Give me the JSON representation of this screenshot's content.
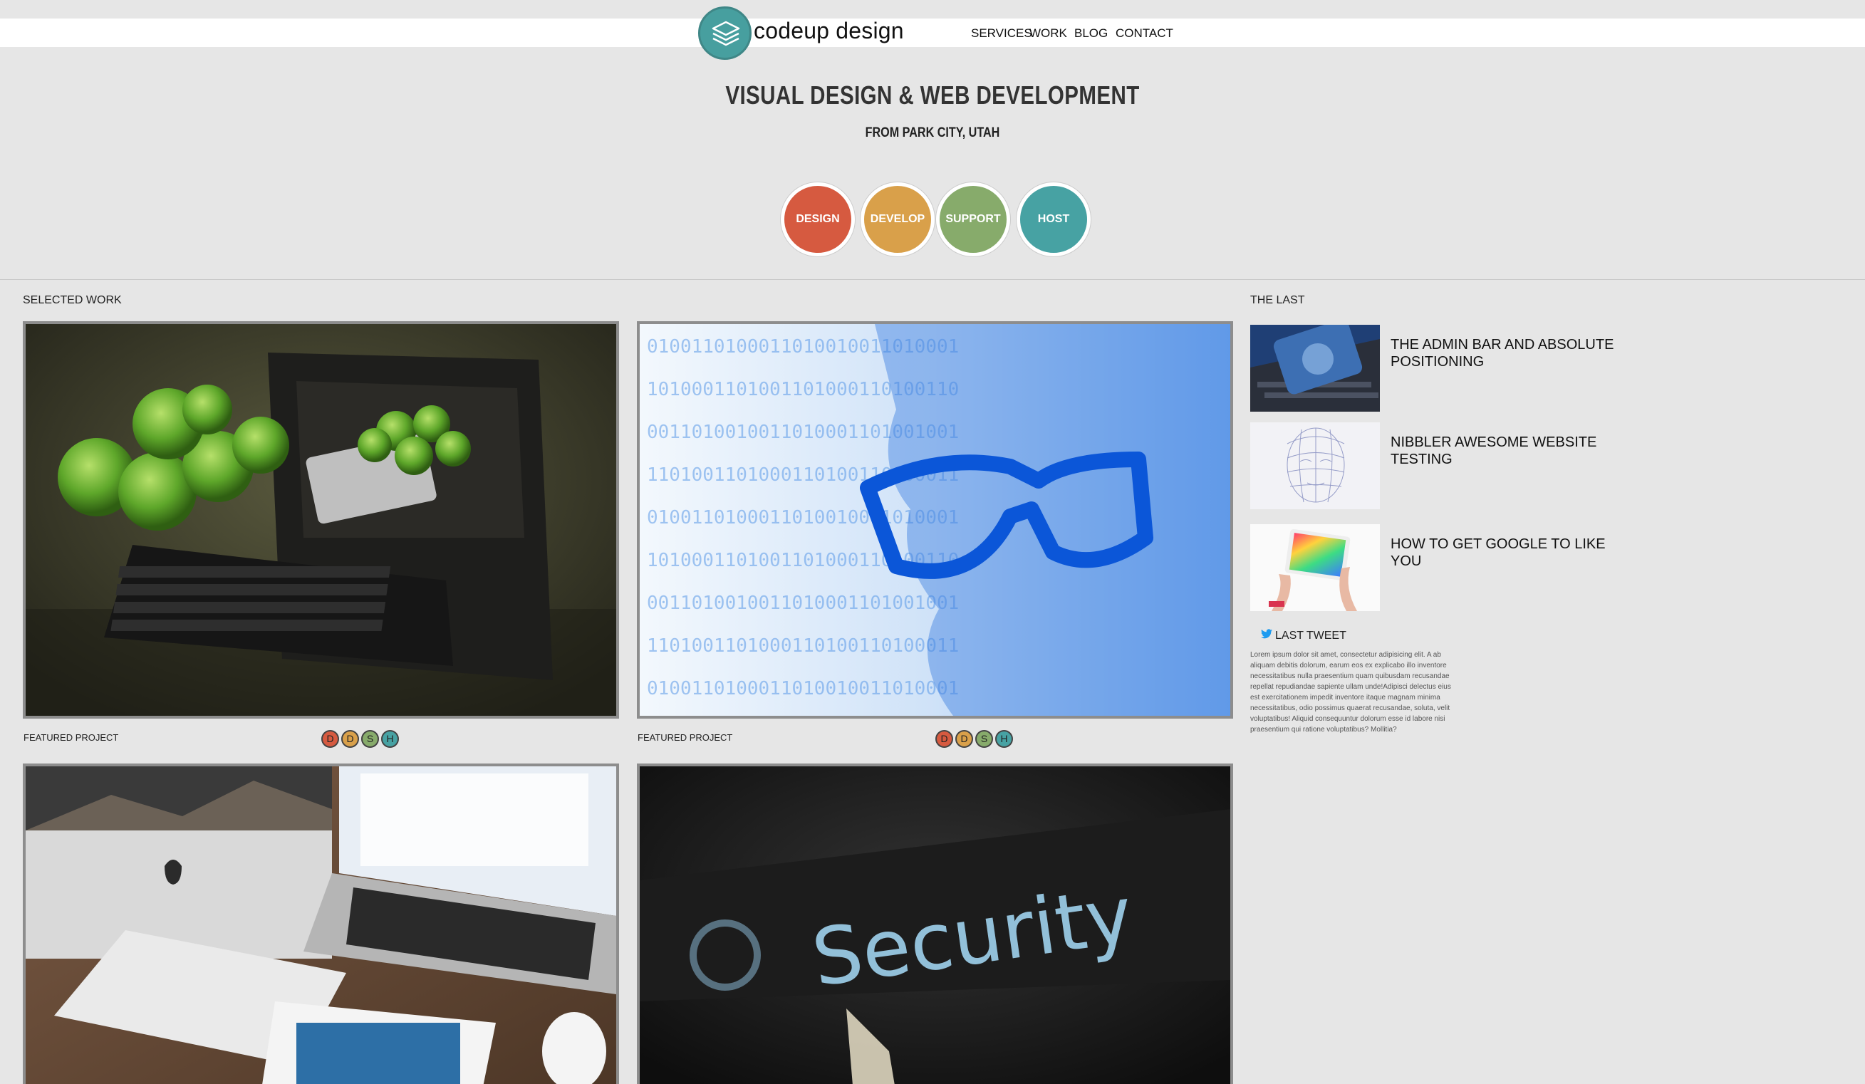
{
  "brand": {
    "name": "codeup design",
    "accent": "#479f9f"
  },
  "nav": [
    "SERVICES",
    "WORK",
    "BLOG",
    "CONTACT"
  ],
  "hero": {
    "title": "VISUAL DESIGN & WEB DEVELOPMENT",
    "subtitle": "FROM PARK CITY, UTAH"
  },
  "services": [
    {
      "label": "DESIGN",
      "color": "#d65a40"
    },
    {
      "label": "DEVELOP",
      "color": "#d9a04a"
    },
    {
      "label": "SUPPORT",
      "color": "#87ab6b"
    },
    {
      "label": "HOST",
      "color": "#47a2a3"
    }
  ],
  "selected_work": {
    "heading": "SELECTED WORK",
    "projects": [
      {
        "caption": "FEATURED PROJECT",
        "image": "apples-and-tablet-photo",
        "tags": [
          "D",
          "D",
          "S",
          "H"
        ]
      },
      {
        "caption": "FEATURED PROJECT",
        "image": "binary-code-face-photo",
        "tags": [
          "D",
          "D",
          "S",
          "H"
        ]
      },
      {
        "caption": "",
        "image": "mac-devices-desk-photo",
        "tags": []
      },
      {
        "caption": "",
        "image": "security-screen-photo",
        "tags": []
      }
    ]
  },
  "sidebar": {
    "heading": "THE LAST",
    "posts": [
      {
        "title": "THE ADMIN BAR AND ABSOLUTE POSITIONING",
        "image": "smartphone-keyboard-photo"
      },
      {
        "title": "NIBBLER AWESOME WEBSITE TESTING",
        "image": "wireframe-face-photo"
      },
      {
        "title": "HOW TO GET GOOGLE TO LIKE YOU",
        "image": "hands-holding-tablet-photo"
      }
    ],
    "tweet": {
      "heading": "LAST TWEET",
      "icon": "twitter-bird-icon",
      "text": "Lorem ipsum dolor sit amet, consectetur adipisicing elit. A ab aliquam debitis dolorum, earum eos ex explicabo illo inventore necessitatibus nulla praesentium quam quibusdam recusandae repellat repudiandae sapiente ullam unde!Adipisci delectus eius est exercitationem impedit inventore itaque magnam minima necessitatibus, odio possimus quaerat recusandae, soluta, velit voluptatibus! Aliquid consequuntur dolorum esse id labore nisi praesentium qui ratione voluptatibus? Mollitia?"
    }
  }
}
